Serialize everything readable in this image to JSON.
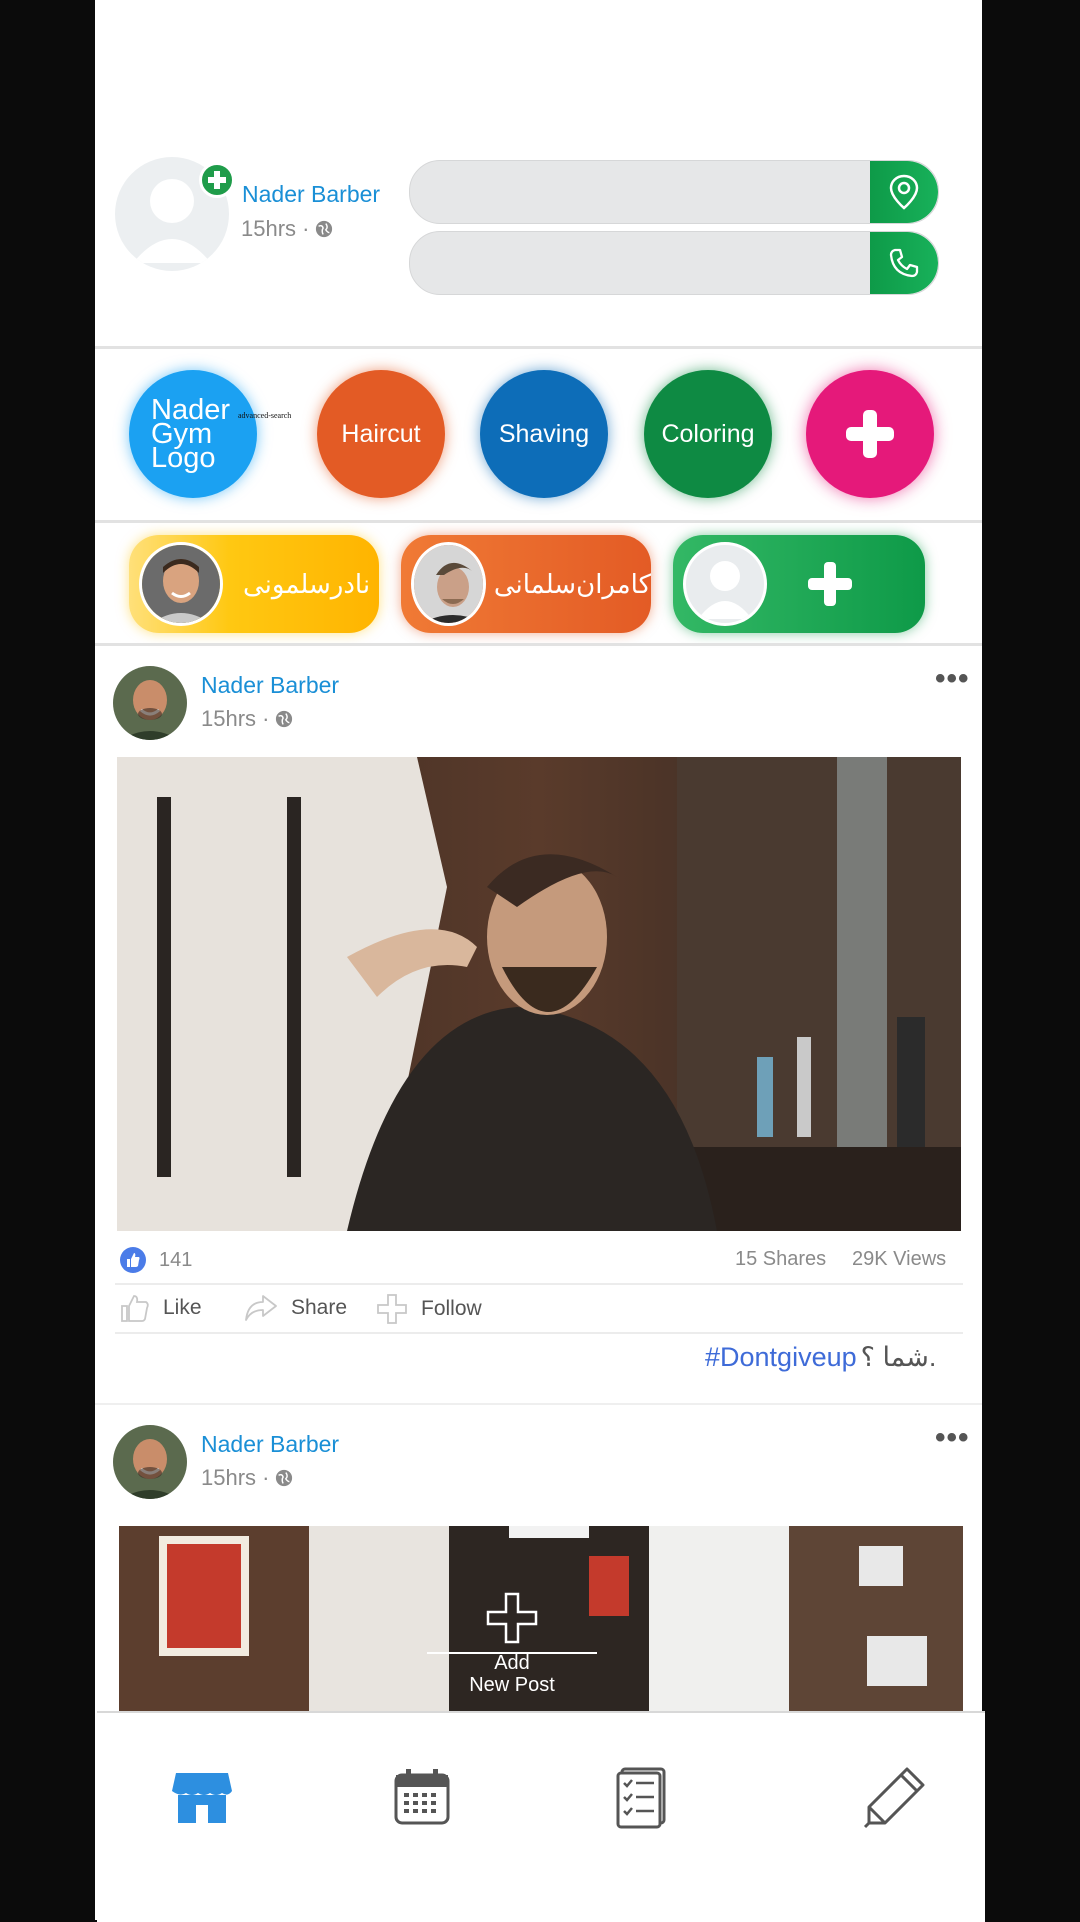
{
  "profile": {
    "name": "Nader Barber",
    "time": "15hrs · "
  },
  "services": {
    "logo_text": "Nader Gym Logo",
    "overlay_label": "advanced-search",
    "items": [
      "Haircut",
      "Shaving",
      "Coloring"
    ],
    "colors": {
      "logo": "#1ba1f2",
      "haircut": "#e35b25",
      "shaving": "#0d6db8",
      "coloring": "#0e8a43",
      "add": "#e5197a"
    }
  },
  "staff": [
    {
      "name": "نادرسلمونی",
      "color": "#ffc812"
    },
    {
      "name": "کامران‌سلمانی",
      "color": "#ea6c2a"
    }
  ],
  "post1": {
    "author": "Nader Barber",
    "time": "15hrs · ",
    "likes": "141",
    "shares": "15 Shares",
    "views": "29K Views",
    "like_label": "Like",
    "share_label": "Share",
    "follow_label": "Follow",
    "caption_tag": "#Dontgiveup",
    "caption_text": "شما ؟."
  },
  "post2": {
    "author": "Nader Barber",
    "time": "15hrs · "
  },
  "add_post": {
    "line1": "Add",
    "line2": "New Post"
  },
  "nav": {
    "active_color": "#2d8fe0",
    "icons": [
      "store-icon",
      "calendar-icon",
      "checklist-icon",
      "pencil-icon"
    ]
  }
}
